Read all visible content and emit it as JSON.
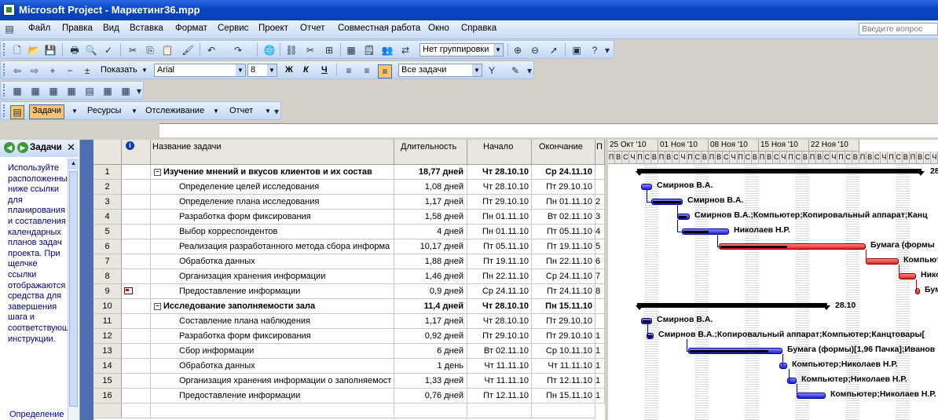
{
  "window": {
    "title": "Microsoft Project - Маркетинг36.mpp"
  },
  "menu": {
    "items": [
      "Файл",
      "Правка",
      "Вид",
      "Вставка",
      "Формат",
      "Сервис",
      "Проект",
      "Отчет",
      "Совместная работа",
      "Окно",
      "Справка"
    ],
    "help_placeholder": "Введите вопрос"
  },
  "toolbar_standard": {
    "grouping": "Нет группировки"
  },
  "toolbar_format": {
    "show_label": "Показать",
    "font": "Arial",
    "size": "8",
    "bold": "Ж",
    "italic": "К",
    "underline": "Ч",
    "filter": "Все задачи"
  },
  "toolbar_guide": {
    "tasks": "Задачи",
    "resources": "Ресурсы",
    "tracking": "Отслеживание",
    "report": "Отчет"
  },
  "side_pane": {
    "title": "Задачи",
    "body": "Используйте расположенные ниже ссылки для планирования и составления календарных планов задач проекта. При щелчке ссылки отображаются средства для завершения шага и соответствующие инструкции.",
    "link": "Определение"
  },
  "grid": {
    "columns": {
      "name": "Название задачи",
      "duration": "Длительность",
      "start": "Начало",
      "finish": "Окончание",
      "pred": "П"
    },
    "rows": [
      {
        "id": "1",
        "name": "Изучение мнений и вкусов клиентов и их состав",
        "dur": "18,77 дней",
        "start": "Чт 28.10.10",
        "end": "Ср 24.11.10",
        "pred": "",
        "summary": true
      },
      {
        "id": "2",
        "name": "Определение целей исследования",
        "dur": "1,08 дней",
        "start": "Чт 28.10.10",
        "end": "Пт 29.10.10",
        "pred": ""
      },
      {
        "id": "3",
        "name": "Определение плана исследования",
        "dur": "1,17 дней",
        "start": "Пт 29.10.10",
        "end": "Пн 01.11.10",
        "pred": "2"
      },
      {
        "id": "4",
        "name": "Разработка форм фиксирования",
        "dur": "1,58 дней",
        "start": "Пн 01.11.10",
        "end": "Вт 02.11.10",
        "pred": "3"
      },
      {
        "id": "5",
        "name": "Выбор корреспондентов",
        "dur": "4 дней",
        "start": "Пн 01.11.10",
        "end": "Пт 05.11.10",
        "pred": "4"
      },
      {
        "id": "6",
        "name": "Реализация разработанного метода сбора информа",
        "dur": "10,17 дней",
        "start": "Пт 05.11.10",
        "end": "Пт 19.11.10",
        "pred": "5"
      },
      {
        "id": "7",
        "name": "Обработка данных",
        "dur": "1,88 дней",
        "start": "Пт 19.11.10",
        "end": "Пн 22.11.10",
        "pred": "6"
      },
      {
        "id": "8",
        "name": "Организация хранения информации",
        "dur": "1,46 дней",
        "start": "Пн 22.11.10",
        "end": "Ср 24.11.10",
        "pred": "7"
      },
      {
        "id": "9",
        "name": "Предоставление информации",
        "dur": "0,9 дней",
        "start": "Ср 24.11.10",
        "end": "Пт 24.11.10",
        "pred": "8",
        "note": true
      },
      {
        "id": "10",
        "name": "Исследование заполняемости зала",
        "dur": "11,4 дней",
        "start": "Чт 28.10.10",
        "end": "Пн 15.11.10",
        "pred": "",
        "summary": true
      },
      {
        "id": "11",
        "name": "Составление плана наблюдения",
        "dur": "1,17 дней",
        "start": "Чт 28.10.10",
        "end": "Пт 29.10.10",
        "pred": ""
      },
      {
        "id": "12",
        "name": "Разработка форм фиксирования",
        "dur": "0,92 дней",
        "start": "Пт 29.10.10",
        "end": "Пт 29.10.10",
        "pred": "1"
      },
      {
        "id": "13",
        "name": "Сбор информации",
        "dur": "6 дней",
        "start": "Вт 02.11.10",
        "end": "Ср 10.11.10",
        "pred": "1"
      },
      {
        "id": "14",
        "name": "Обработка данных",
        "dur": "1 день",
        "start": "Чт 11.11.10",
        "end": "Чт 11.11.10",
        "pred": "1"
      },
      {
        "id": "15",
        "name": "Организация хранения информации о заполняемост",
        "dur": "1,33 дней",
        "start": "Чт 11.11.10",
        "end": "Пт 12.11.10",
        "pred": "1"
      },
      {
        "id": "16",
        "name": "Предоставление информации",
        "dur": "0,76 дней",
        "start": "Пт 12.11.10",
        "end": "Пн 15.11.10",
        "pred": "1"
      }
    ]
  },
  "gantt": {
    "weeks": [
      "25 Окт '10",
      "01 Ноя '10",
      "08 Ноя '10",
      "15 Ноя '10",
      "22 Ноя '10"
    ],
    "days": [
      "П",
      "В",
      "С",
      "Ч",
      "П",
      "С",
      "В"
    ],
    "labels": {
      "s1": "28",
      "r2": "Смирнов В.А.",
      "r3": "Смирнов В.А.",
      "r4": "Смирнов В.А.;Компьютер;Копировальный аппарат;Канц",
      "r5": "Николаев Н.Р.",
      "r6": "Бумага (формы",
      "r7": "Компьют",
      "r8": "Нико",
      "r9": "Бум",
      "s10": "28.10",
      "r11": "Смирнов В.А.",
      "r12": "Смирнов В.А.;Копировальный аппарат;Компьютер;Канцтовары[",
      "r13": "Бумага (формы)[1,96 Пачка];Иванов",
      "r14": "Компьютер;Николаев Н.Р.",
      "r15": "Компьютер;Николаев Н.Р.",
      "r16": "Компьютер;Николаев Н.Р."
    }
  }
}
